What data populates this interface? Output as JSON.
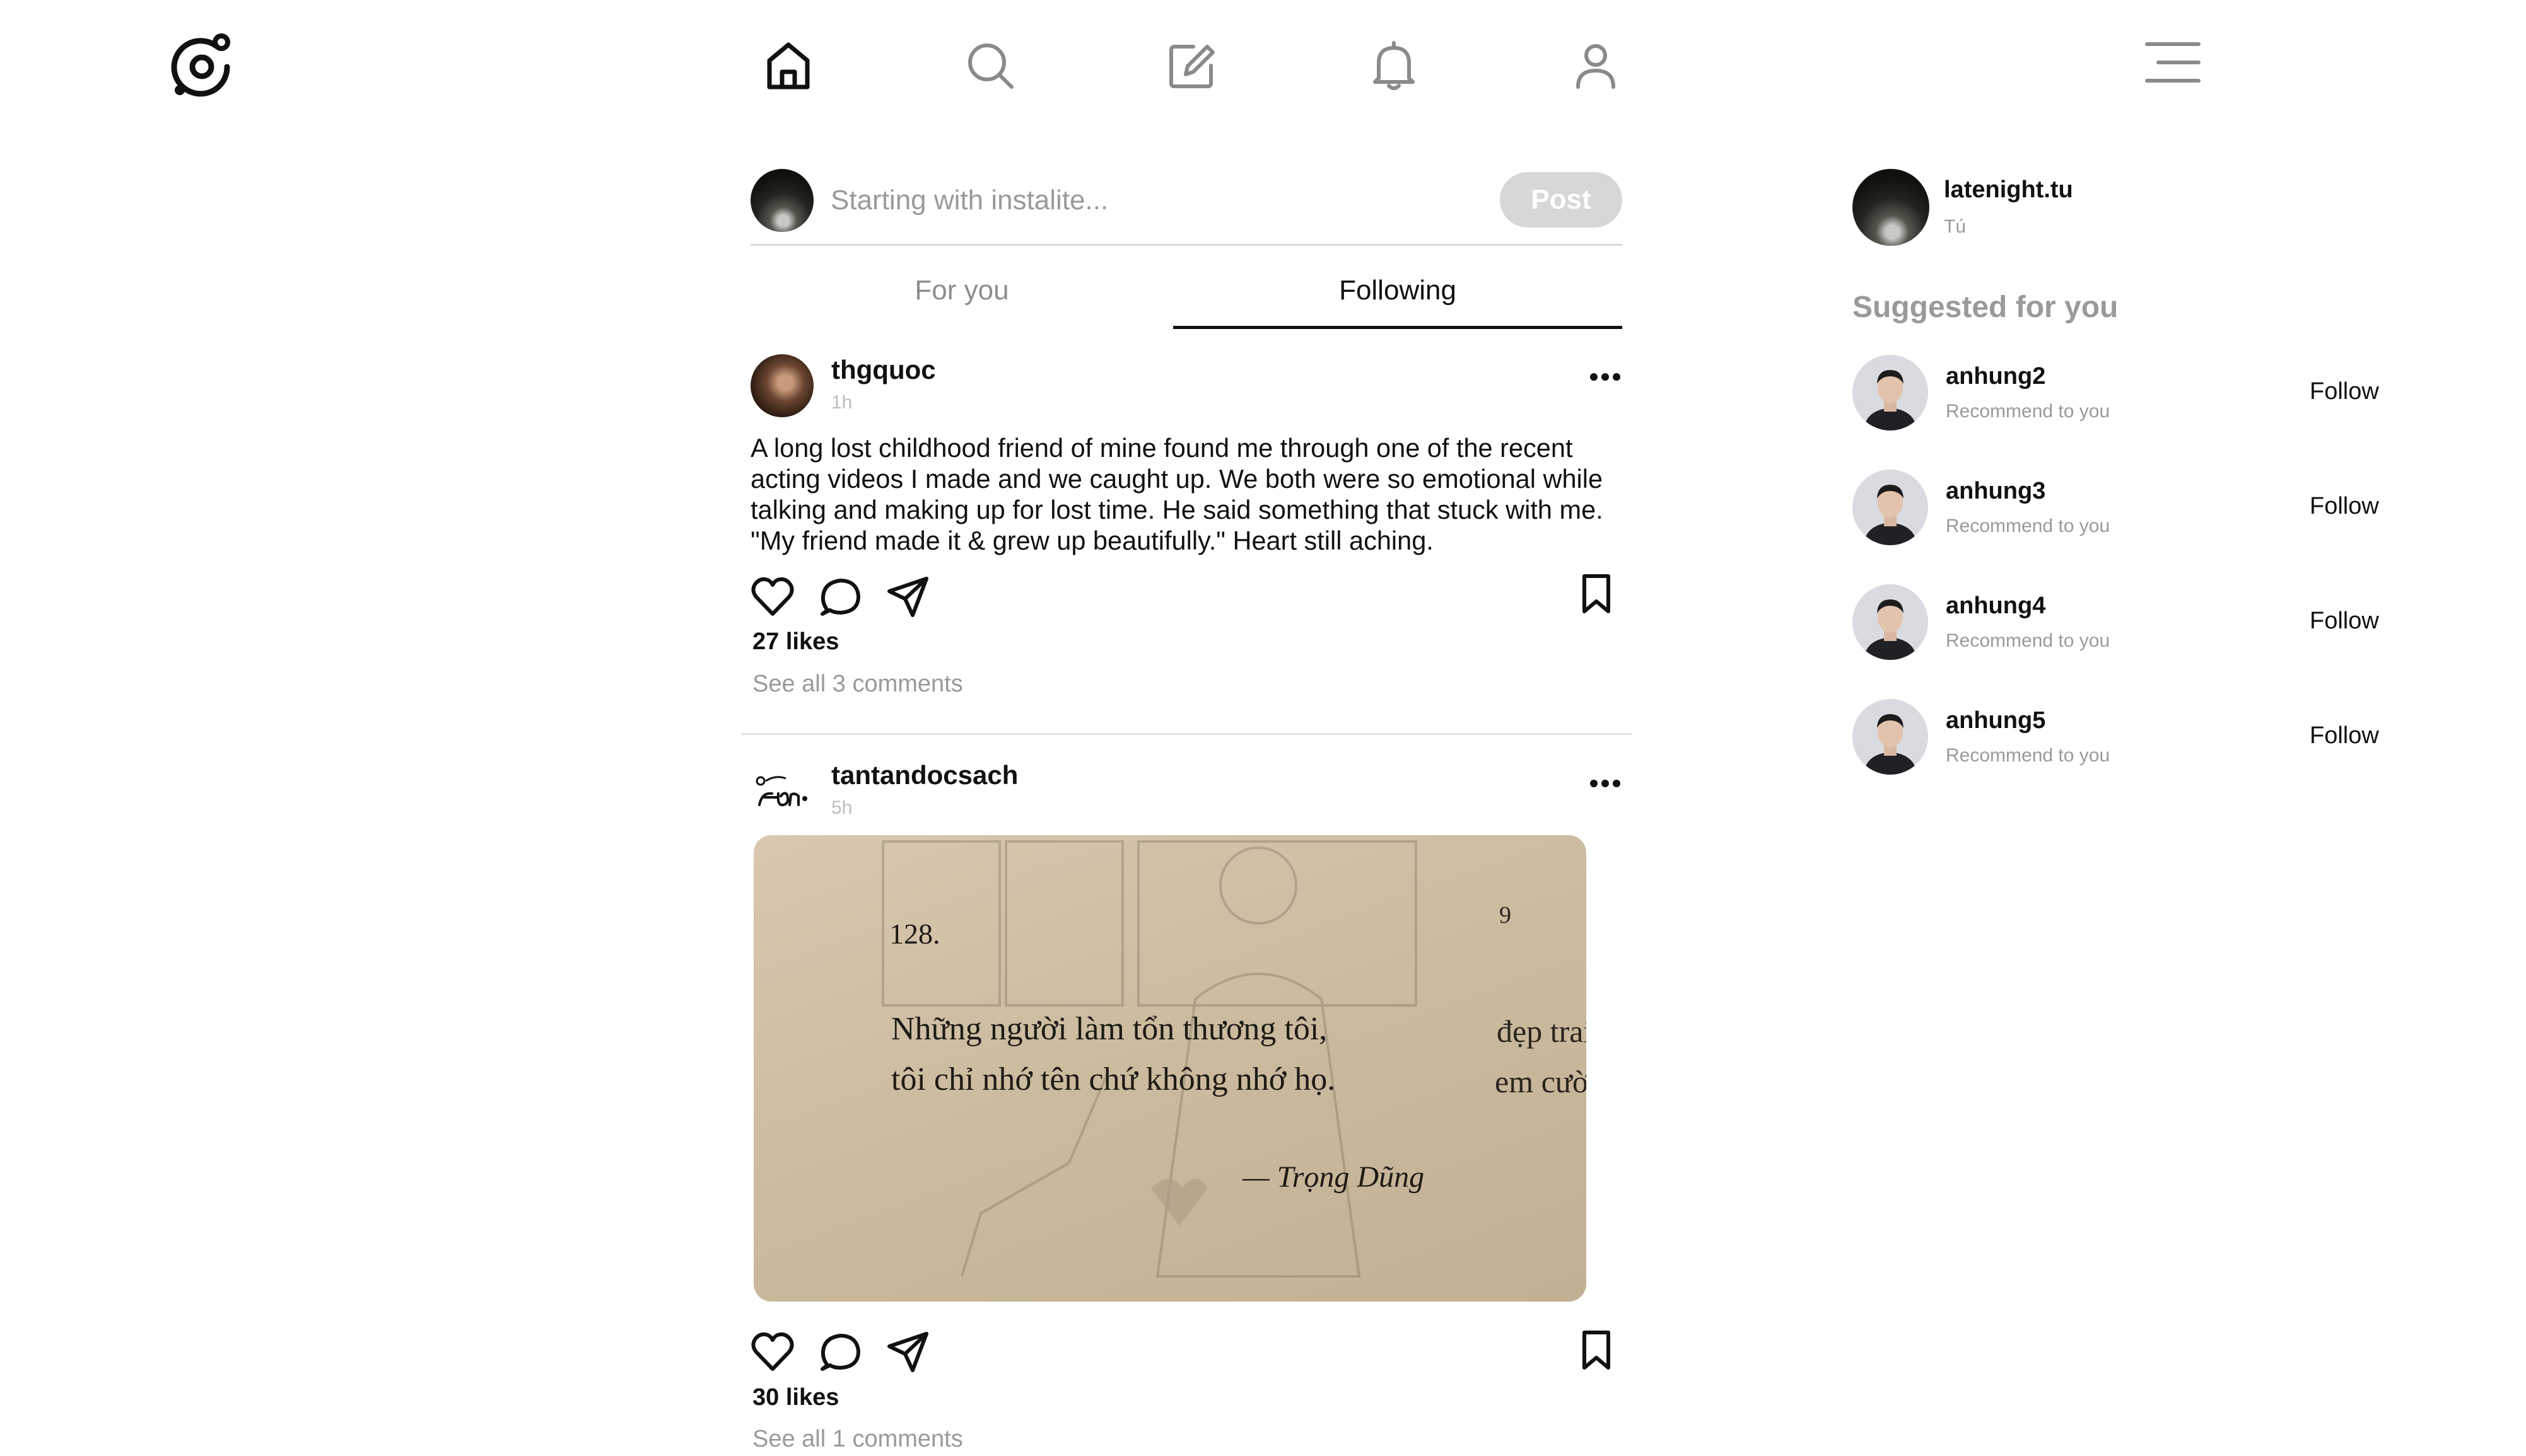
{
  "nav": {
    "items": [
      "home-icon",
      "search-icon",
      "compose-icon",
      "notifications-icon",
      "profile-icon"
    ],
    "active": "home-icon"
  },
  "composer": {
    "placeholder": "Starting with instalite...",
    "post_label": "Post"
  },
  "tabs": [
    {
      "label": "For you",
      "active": false
    },
    {
      "label": "Following",
      "active": true
    }
  ],
  "posts": [
    {
      "username": "thgquoc",
      "time": "1h",
      "text": "A long lost childhood friend of mine found me through one of the recent acting videos I made and we caught up. We both were so emotional while talking and making up for lost time. He said something that stuck with me. \"My friend made it & grew up beautifully.\" Heart still aching.",
      "likes": "27 likes",
      "comments": "See all 3 comments"
    },
    {
      "username": "tantandocsach",
      "time": "5h",
      "image": {
        "number": "128.",
        "line1": "Những người làm tổn thương tôi,",
        "line2": "tôi chỉ nhớ tên chứ không nhớ họ.",
        "author": "— Trọng Dũng",
        "edge1": "9",
        "edge2": "đẹp trai lọ",
        "edge3": "em cười đ"
      },
      "likes": "30 likes",
      "comments": "See all 1 comments"
    }
  ],
  "sidebar": {
    "me": {
      "username": "latenight.tu",
      "fullname": "Tú"
    },
    "suggested_title": "Suggested for you",
    "suggestions": [
      {
        "username": "anhung2",
        "subtitle": "Recommend to you",
        "action": "Follow"
      },
      {
        "username": "anhung3",
        "subtitle": "Recommend to you",
        "action": "Follow"
      },
      {
        "username": "anhung4",
        "subtitle": "Recommend to you",
        "action": "Follow"
      },
      {
        "username": "anhung5",
        "subtitle": "Recommend to you",
        "action": "Follow"
      }
    ]
  },
  "colors": {
    "text": "#111111",
    "muted": "#9a9a9a",
    "post_button_disabled": "#d7d7d9",
    "divider": "#d9d9d9"
  }
}
